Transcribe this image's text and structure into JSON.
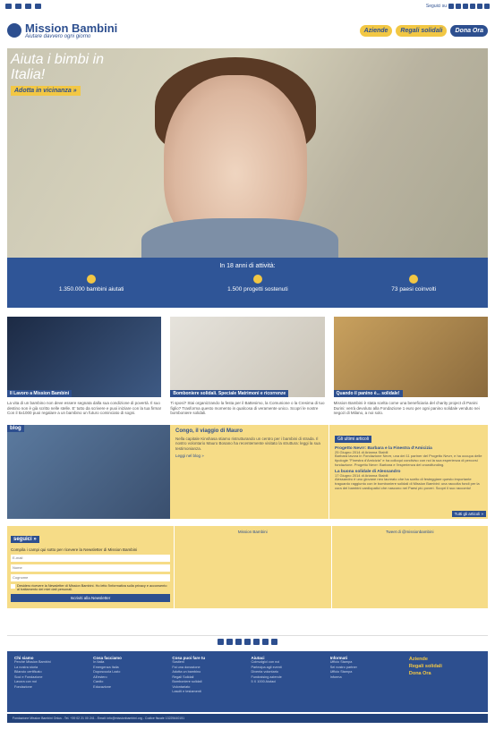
{
  "header": {
    "social_label": "Seguici su",
    "logo_name": "Mission Bambini",
    "logo_tagline": "Aiutare davvero ogni giorno",
    "btn_aziende": "Aziende",
    "btn_regali": "Regali solidali",
    "btn_dona": "Dona Ora"
  },
  "hero": {
    "title": "Aiuta i bimbi in Italia!",
    "cta": "Adotta in vicinanza »"
  },
  "stats": {
    "title": "In 18 anni di attività:",
    "items": [
      {
        "label": "1.350.000 bambini aiutati"
      },
      {
        "label": "1.500 progetti sostenuti"
      },
      {
        "label": "73 paesi coinvolti"
      }
    ]
  },
  "cards": [
    {
      "caption": "Il Lavoro a Mission Bambini",
      "text": "La vita di un bambino non deve essere segnata dalla sua condizione di povertà. Il suo destino non è già scritto nelle stelle. E' tutto da scrivere e puoi iniziare con la tua firma! Con il 5x1000 puoi regalare a un bambino un futuro cominciato di sogni."
    },
    {
      "caption": "Bomboniere solidali. Speciale Matrimoni e ricorrenze",
      "text": "Ti sposi? Stai organizzando la festa per il Battesimo, la Comunione o la Cresima di tuo figlio? Trasforma questo momento in qualcosa di veramente unico. Scopri le nostre bomboniere solidali."
    },
    {
      "caption": "Quando il panino è... solidale!",
      "text": "Mission Bambini è stata scelta come una beneficiaria del charity project di Panini Durini: verrà devoluto alla Fondazione 1 euro per ogni panino solidale venduto nei negozi di Milano, a noi solo."
    }
  ],
  "blog": {
    "tag": "blog",
    "title": "Congo, il viaggio di Mauro",
    "text": "Nella capitale Kinshasa stiamo ristrutturando un centro per i bambini di strada. Il nostro volontario Mauro Bosano ha recentemente visitato la struttura: leggi la sua testimonianza.",
    "link": "Leggi nel blog »",
    "latest_tag": "Gli ultimi articoli",
    "posts": [
      {
        "title": "Progetto Nevrr: Barbara e la Finestra d'Amicizia",
        "date": "25 Giugno 2014 di Arianna Stabili",
        "text": "Barbara lavora in Fondazione Nevrr, una dei 11 partner del Progetto Nevrr, e ha occupa delle tipologie \"Finestra d'Amicizia\" e ha colloqui condiviso con noi la sua esperienza di percorsi fondazione. Progetto Nevrr: Barbara e l'esperienza del crowdfunding."
      },
      {
        "title": "La buona solidale di Alessandro",
        "date": "17 Giugno 2014 di Arianna Stabili",
        "text": "Alessandro è uno giovane neo laureato che ha scelto di festeggiare questo importante traguardo raggiunto con le bomboniere solidali di Mission Bambini: una raccolta fondi per la cura dei bambini cardiopatici che nascono nei Paesi più poveri. Scopri il suo racconto!"
      }
    ],
    "all_posts": "Tutti gli articoli »"
  },
  "newsletter": {
    "tag": "seguici »",
    "intro": "Compila i campi qui sotto per ricevere la Newsletter di Mission Bambini",
    "email_ph": "E-mail",
    "name_ph": "Nome",
    "surname_ph": "Cognome",
    "privacy": "Desidero ricevere la Newsletter di Mission Bambini. Ho letto l'informativa sulla privacy e acconsento al trattamento dei miei dati personali.",
    "submit": "Iscriviti alla Newsletter",
    "fb_label": "Mission Bambini",
    "tw_label": "Tweet di @missionbambini"
  },
  "footer": {
    "cols": [
      {
        "head": "Chi siamo",
        "items": [
          "Perché Mission Bambini",
          "La nostra storia",
          "Bilancio certificato",
          "Soci e Fondazione",
          "Lavora con noi",
          "Fondazione"
        ]
      },
      {
        "head": "Cosa facciamo",
        "items": [
          "In Italia",
          "Emergenza Italia",
          "Doposcuola Lazio",
          "All'estero",
          "Cardio",
          "Educazione"
        ]
      },
      {
        "head": "Cosa puoi fare tu",
        "items": [
          "Sostieni",
          "Fai una donazione",
          "Adotta un bambino",
          "Regali Solidali",
          "Bomboniere solidali",
          "Volontariato",
          "Lasciti e testamenti"
        ]
      },
      {
        "head": "Aiutaci",
        "items": [
          "Coinvolgici con noi",
          "Partecipa agli eventi",
          "Diventa volontario",
          "Fundraising aziende",
          "5 X 1000 Aiutaci"
        ]
      },
      {
        "head": "Informati",
        "items": [
          "Ufficio Stampa",
          "Sei nostro partner",
          "Ufficio Stampa",
          "Informa"
        ]
      }
    ],
    "big_links": [
      "Aziende",
      "Regali solidali",
      "Dona Ora"
    ]
  },
  "legal": "Fondazione Mission Bambini Onlus - Tel. +39 02 21 00 241 - Email: info@missionbambini.org - Codice fiscale 13225440151"
}
